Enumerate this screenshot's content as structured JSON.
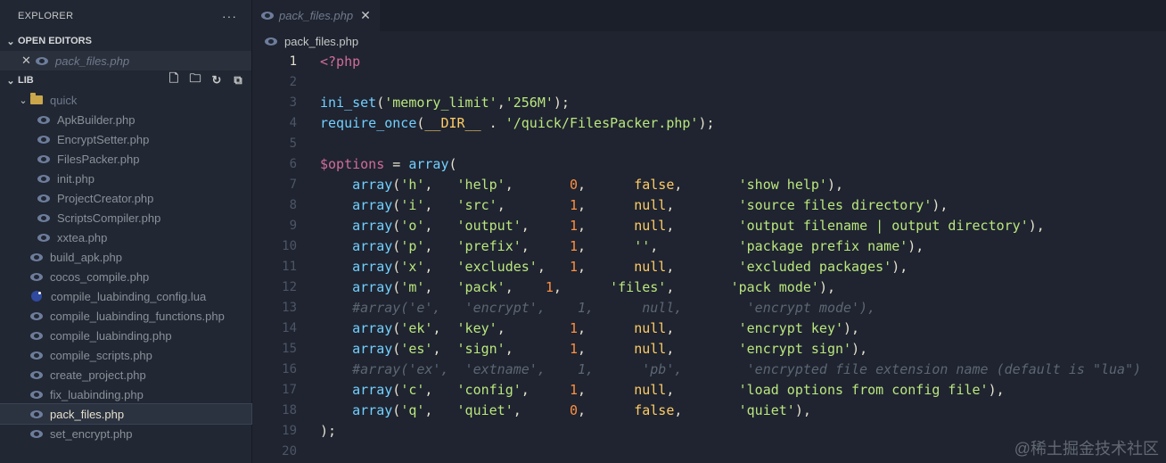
{
  "explorer": {
    "title": "EXPLORER",
    "more_label": "···",
    "open_editors_label": "OPEN EDITORS",
    "open_editors": [
      {
        "name": "pack_files.php"
      }
    ],
    "lib_label": "LIB",
    "folder": {
      "name": "quick",
      "files": [
        "ApkBuilder.php",
        "EncryptSetter.php",
        "FilesPacker.php",
        "init.php",
        "ProjectCreator.php",
        "ScriptsCompiler.php",
        "xxtea.php"
      ]
    },
    "root_files": [
      "build_apk.php",
      "cocos_compile.php",
      "compile_luabinding_config.lua",
      "compile_luabinding_functions.php",
      "compile_luabinding.php",
      "compile_scripts.php",
      "create_project.php",
      "fix_luabinding.php",
      "pack_files.php",
      "set_encrypt.php"
    ],
    "selected": "pack_files.php"
  },
  "editor": {
    "tab_label": "pack_files.php",
    "breadcrumb": "pack_files.php",
    "lines": [
      "<?php",
      "",
      "ini_set('memory_limit','256M');",
      "require_once(__DIR__ . '/quick/FilesPacker.php');",
      "",
      "$options = array(",
      "    array('h',   'help',       0,      false,       'show help'),",
      "    array('i',   'src',        1,      null,        'source files directory'),",
      "    array('o',   'output',     1,      null,        'output filename | output directory'),",
      "    array('p',   'prefix',     1,      '',          'package prefix name'),",
      "    array('x',   'excludes',   1,      null,        'excluded packages'),",
      "    array('m',   'pack',    1,      'files',       'pack mode'),",
      "    #array('e',   'encrypt',    1,      null,        'encrypt mode'),",
      "    array('ek',  'key',        1,      null,        'encrypt key'),",
      "    array('es',  'sign',       1,      null,        'encrypt sign'),",
      "    #array('ex',  'extname',    1,      'pb',        'encrypted file extension name (default is \"lua\")",
      "    array('c',   'config',     1,      null,        'load options from config file'),",
      "    array('q',   'quiet',      0,      false,       'quiet'),",
      ");",
      ""
    ],
    "line_numbers": [
      "1",
      "2",
      "3",
      "4",
      "5",
      "6",
      "7",
      "8",
      "9",
      "10",
      "11",
      "12",
      "13",
      "14",
      "15",
      "16",
      "17",
      "18",
      "19",
      "20"
    ]
  },
  "watermark": "@稀土掘金技术社区"
}
